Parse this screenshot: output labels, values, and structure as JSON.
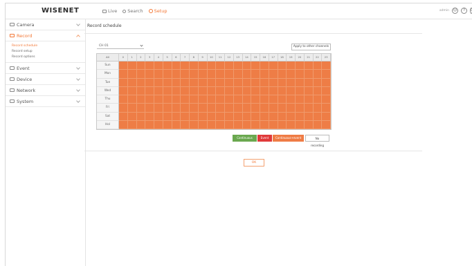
{
  "header": {
    "logo": "WISENET",
    "nav": [
      {
        "label": "Live",
        "icon": "monitor-icon"
      },
      {
        "label": "Search",
        "icon": "search-icon"
      },
      {
        "label": "Setup",
        "icon": "gear-icon"
      }
    ],
    "user": "admin",
    "right_icons": [
      "user-icon",
      "help-icon",
      "power-icon"
    ]
  },
  "sidebar": {
    "items": [
      {
        "label": "Camera",
        "icon": "camera-icon"
      },
      {
        "label": "Record",
        "icon": "record-icon",
        "sub": [
          "Record schedule",
          "Record setup",
          "Record options"
        ]
      },
      {
        "label": "Event",
        "icon": "event-icon"
      },
      {
        "label": "Device",
        "icon": "device-icon"
      },
      {
        "label": "Network",
        "icon": "network-icon"
      },
      {
        "label": "System",
        "icon": "system-icon"
      }
    ]
  },
  "page": {
    "title": "Record schedule",
    "channel_select": "CH 01",
    "apply_label": "Apply to other channels",
    "ok_label": "OK"
  },
  "schedule": {
    "all_label": "All",
    "hours": [
      "0",
      "1",
      "2",
      "3",
      "4",
      "5",
      "6",
      "7",
      "8",
      "9",
      "10",
      "11",
      "12",
      "13",
      "14",
      "15",
      "16",
      "17",
      "18",
      "19",
      "20",
      "21",
      "22",
      "23"
    ],
    "days": [
      "Sun",
      "Mon",
      "Tue",
      "Wed",
      "Thu",
      "Fri",
      "Sat",
      "Hol"
    ],
    "fill_color": "#ee7d46"
  },
  "legend": {
    "continuous": "Continuous",
    "event": "Event",
    "cont_event": "Continuous+event",
    "none": "No recording",
    "colors": {
      "continuous": "#6aa84f",
      "event": "#e03a3a",
      "cont_event": "#ef7c45",
      "none": "#ffffff"
    }
  }
}
